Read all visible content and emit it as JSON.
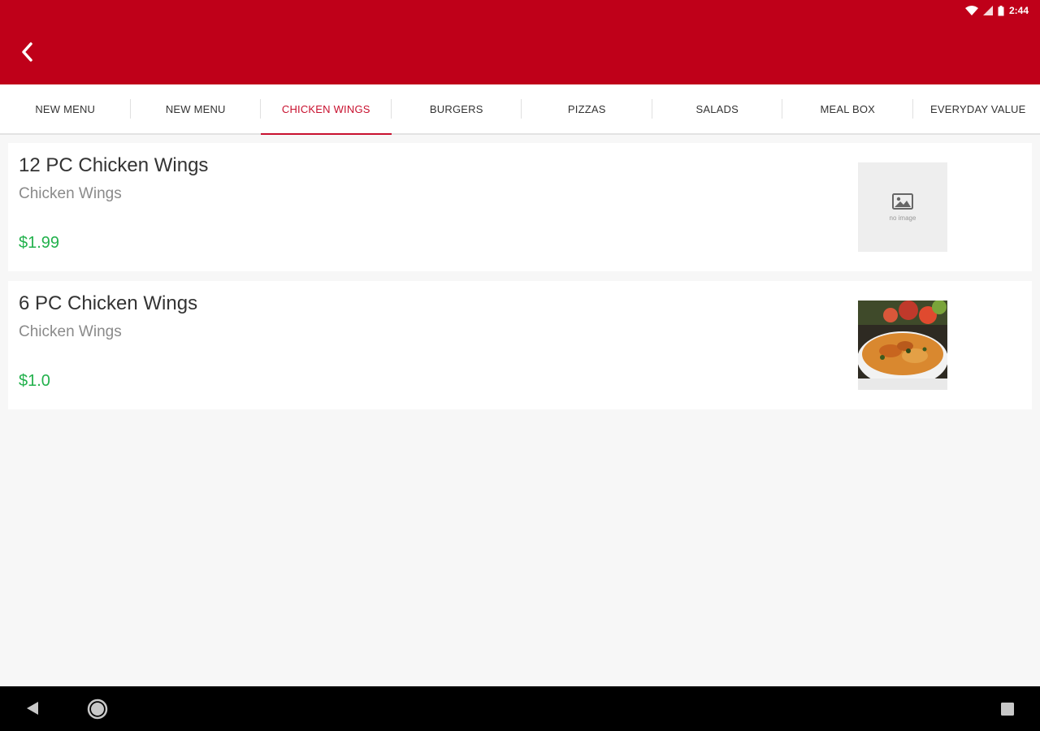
{
  "status": {
    "time": "2:44"
  },
  "header": {
    "back_icon": "chevron-left-icon"
  },
  "tabs": [
    {
      "label": "NEW MENU",
      "active": false
    },
    {
      "label": "NEW MENU",
      "active": false
    },
    {
      "label": "CHICKEN WINGS",
      "active": true
    },
    {
      "label": "BURGERS",
      "active": false
    },
    {
      "label": "PIZZAS",
      "active": false
    },
    {
      "label": "SALADS",
      "active": false
    },
    {
      "label": "MEAL BOX",
      "active": false
    },
    {
      "label": "EVERYDAY VALUE",
      "active": false
    }
  ],
  "items": [
    {
      "name": "12 PC Chicken Wings",
      "category": "Chicken Wings",
      "price": "$1.99",
      "image_label": "no image"
    },
    {
      "name": "6 PC Chicken Wings",
      "category": "Chicken Wings",
      "price": "$1.0"
    }
  ],
  "colors": {
    "brand": "#bf0019",
    "accent": "#c8102e",
    "price": "#22b14c"
  },
  "navbar": {
    "icons": [
      "back-triangle-icon",
      "home-circle-icon",
      "recents-square-icon"
    ]
  }
}
